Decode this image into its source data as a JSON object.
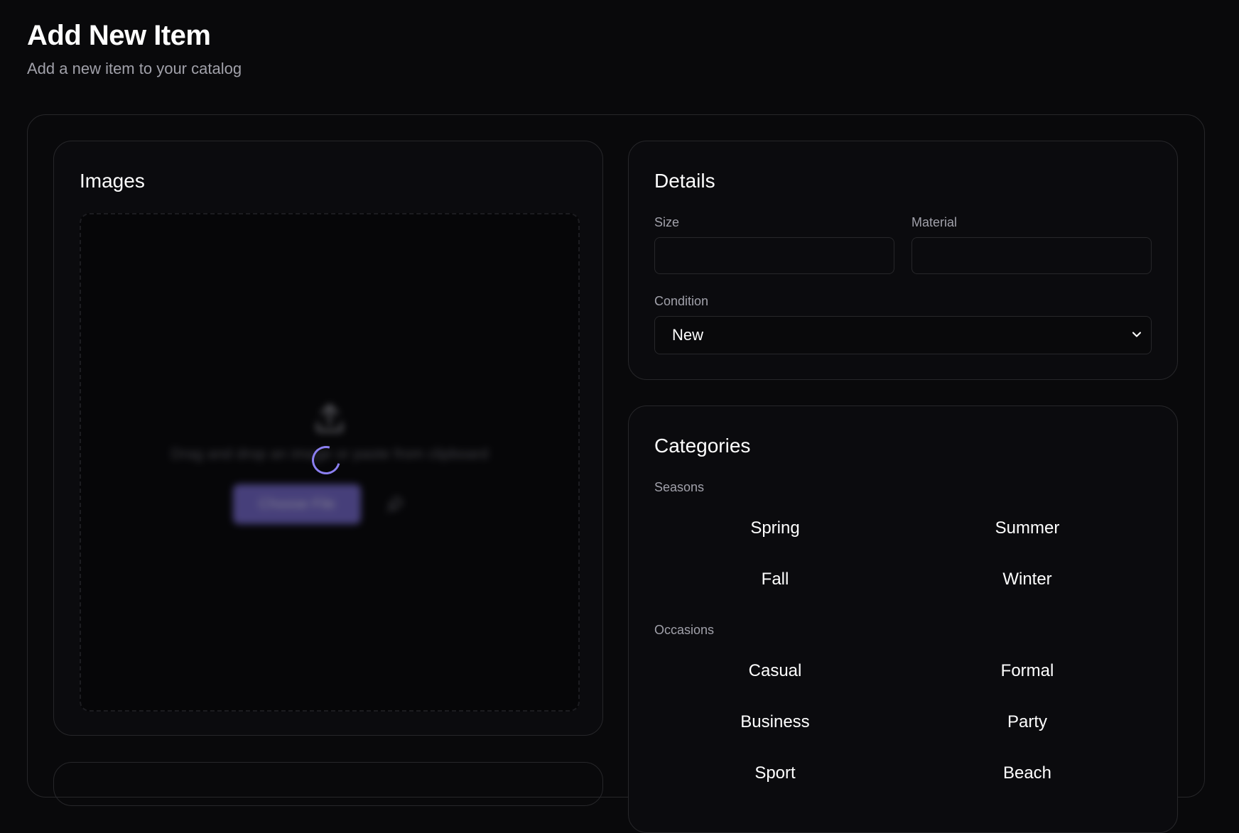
{
  "header": {
    "title": "Add New Item",
    "subtitle": "Add a new item to your catalog"
  },
  "images": {
    "title": "Images",
    "dropzone_text": "Drag and drop an image or paste from clipboard",
    "choose_button": "Choose File",
    "accent_color": "#7c6fd8"
  },
  "details": {
    "title": "Details",
    "size_label": "Size",
    "size_value": "",
    "material_label": "Material",
    "material_value": "",
    "condition_label": "Condition",
    "condition_value": "New"
  },
  "categories": {
    "title": "Categories",
    "seasons_label": "Seasons",
    "seasons": [
      "Spring",
      "Summer",
      "Fall",
      "Winter"
    ],
    "occasions_label": "Occasions",
    "occasions": [
      "Casual",
      "Formal",
      "Business",
      "Party",
      "Sport",
      "Beach"
    ]
  }
}
